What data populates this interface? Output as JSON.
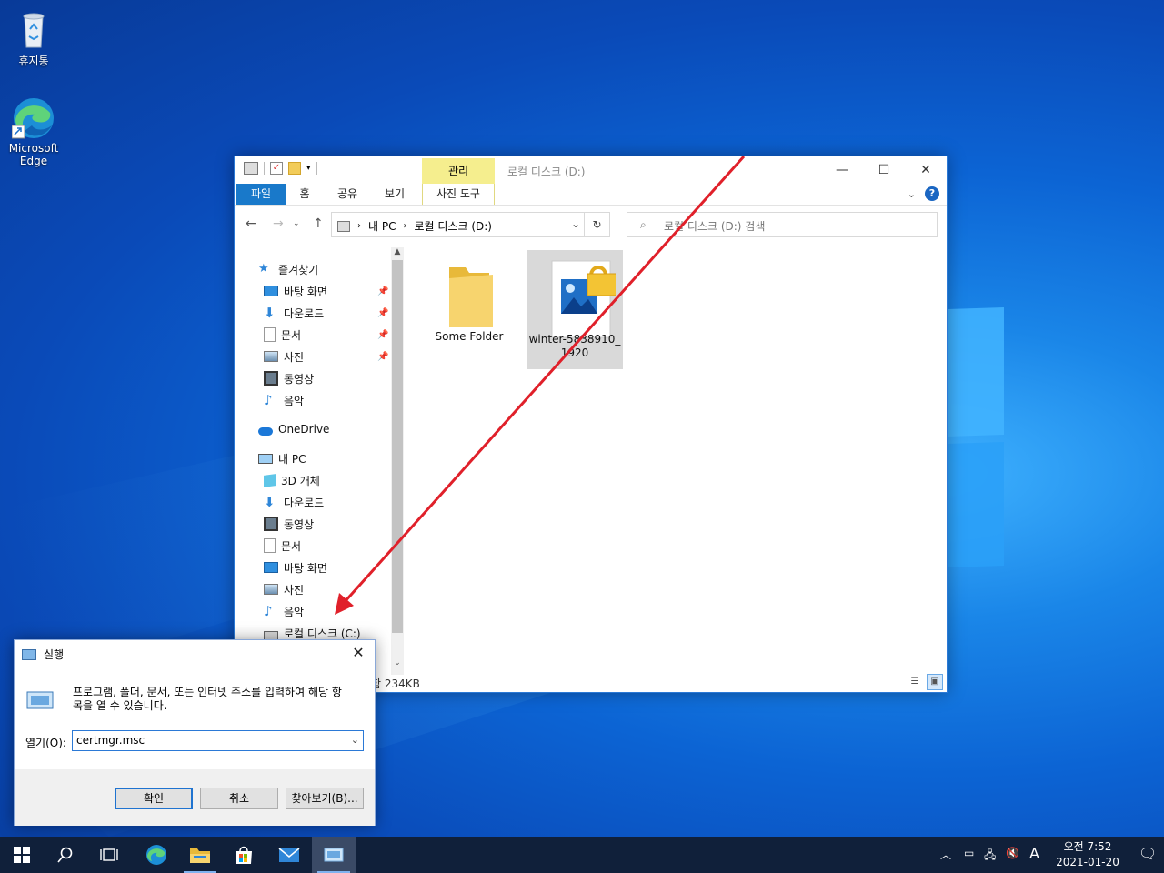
{
  "desktop": {
    "icons": [
      {
        "label": "휴지통",
        "icon": "recycle-bin-icon"
      },
      {
        "label": "Microsoft Edge",
        "icon": "edge-icon"
      }
    ]
  },
  "explorer": {
    "title": "로컬 디스크 (D:)",
    "context_tab": "관리",
    "ribbon_tabs": [
      "파일",
      "홈",
      "공유",
      "보기",
      "사진 도구"
    ],
    "address": {
      "segments": [
        "내 PC",
        "로컬 디스크 (D:)"
      ]
    },
    "search_placeholder": "로컬 디스크 (D:) 검색",
    "nav": {
      "quick_access": "즐겨찾기",
      "quick_items": [
        "바탕 화면",
        "다운로드",
        "문서",
        "사진",
        "동영상",
        "음악"
      ],
      "onedrive": "OneDrive",
      "this_pc": "내 PC",
      "pc_items": [
        "3D 개체",
        "다운로드",
        "동영상",
        "문서",
        "바탕 화면",
        "사진",
        "음악",
        "로컬 디스크 (C:)"
      ]
    },
    "files": [
      {
        "name": "Some Folder",
        "type": "folder",
        "selected": false
      },
      {
        "name": "winter-5838910_1920",
        "line1": "winter-5838910_",
        "line2": "1920",
        "type": "image-locked",
        "selected": true
      }
    ],
    "status": "함 234KB"
  },
  "run_dialog": {
    "title": "실행",
    "description": "프로그램, 폴더, 문서, 또는 인터넷 주소를 입력하여 해당 항목을 열 수 있습니다.",
    "desc_line1": "프로그램, 폴더, 문서, 또는 인터넷 주소를 입력하여 해당 항",
    "desc_line2": "목을 열 수 있습니다.",
    "open_label": "열기(O):",
    "input_value": "certmgr.msc",
    "ok": "확인",
    "cancel": "취소",
    "browse": "찾아보기(B)..."
  },
  "taskbar": {
    "clock_time": "오전 7:52",
    "clock_date": "2021-01-20",
    "ime": "A"
  },
  "colors": {
    "accent": "#1979ca",
    "arrow": "#e0202a",
    "context_tab": "#f5ee8e"
  }
}
